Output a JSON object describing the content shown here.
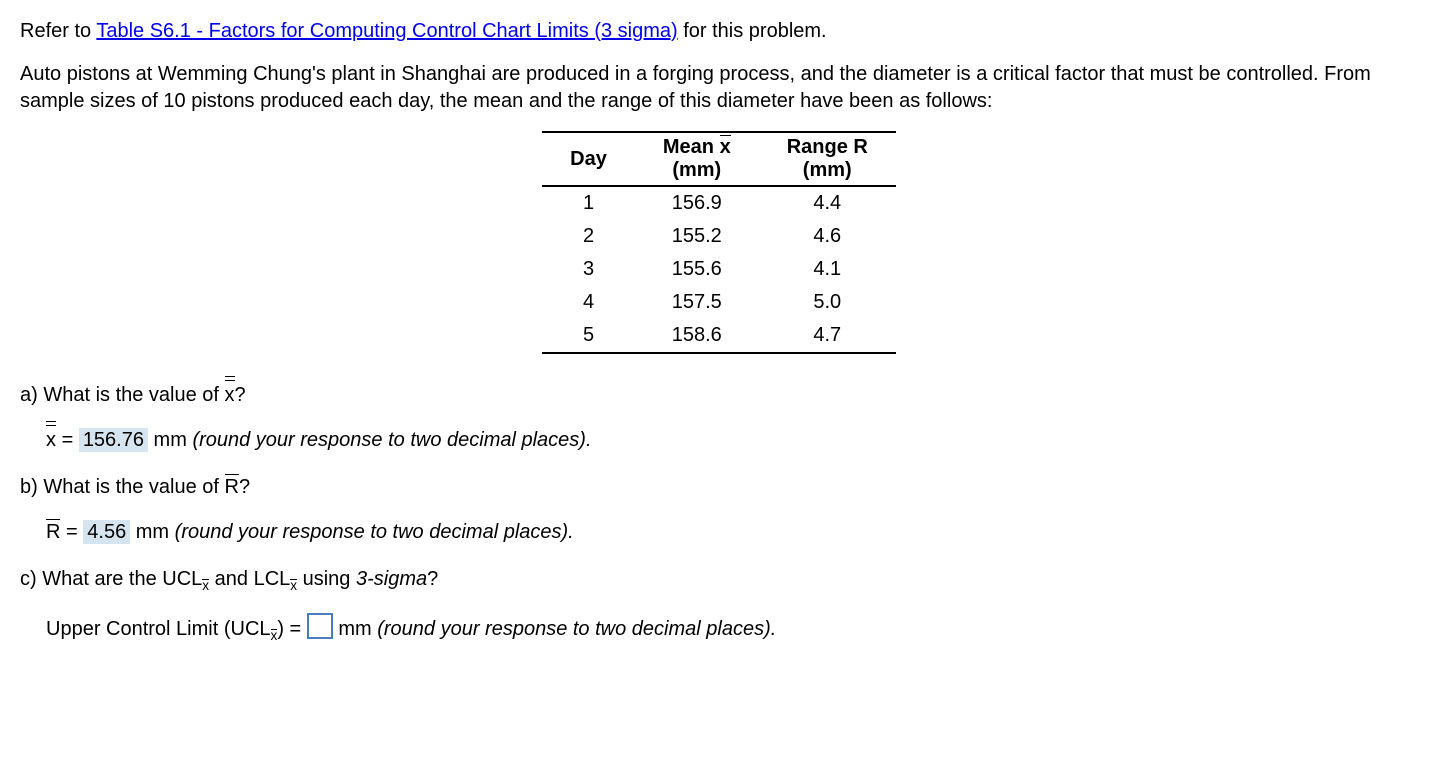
{
  "intro": {
    "prefix": "Refer to ",
    "link": "Table S6.1 - Factors for Computing Control Chart Limits (3 sigma)",
    "suffix": " for this problem."
  },
  "scenario": "Auto pistons at Wemming Chung's plant in Shanghai are produced in a forging process, and the diameter is a critical factor that must be controlled. From sample sizes of 10 pistons produced each day, the mean and the range of this diameter have been as follows:",
  "table": {
    "headers": {
      "day": "Day",
      "mean_line1": "Mean x",
      "mean_line2": "(mm)",
      "range_line1": "Range R",
      "range_line2": "(mm)"
    },
    "rows": [
      {
        "day": "1",
        "mean": "156.9",
        "range": "4.4"
      },
      {
        "day": "2",
        "mean": "155.2",
        "range": "4.6"
      },
      {
        "day": "3",
        "mean": "155.6",
        "range": "4.1"
      },
      {
        "day": "4",
        "mean": "157.5",
        "range": "5.0"
      },
      {
        "day": "5",
        "mean": "158.6",
        "range": "4.7"
      }
    ]
  },
  "qa": {
    "label": "a) What is the value of ",
    "var": "x",
    "qmark": "?"
  },
  "ansA": {
    "lhs": "x =",
    "value": "156.76",
    "unit": " mm ",
    "hint": "(round your response to two decimal places)."
  },
  "qb": {
    "label": "b) What is the value of ",
    "var": "R",
    "qmark": "?"
  },
  "ansB": {
    "lhs": "R =",
    "value": "4.56",
    "unit": " mm ",
    "hint": "(round your response to two decimal places)."
  },
  "qc": {
    "prefix": "c) What are the UCL",
    "mid": " and LCL",
    "suffix": " using ",
    "sigma": "3-sigma",
    "qmark": "?"
  },
  "ansC": {
    "lhs1": "Upper Control Limit (UCL",
    "lhs2": ") = ",
    "unit": " mm ",
    "hint": "(round your response to two decimal places)."
  }
}
